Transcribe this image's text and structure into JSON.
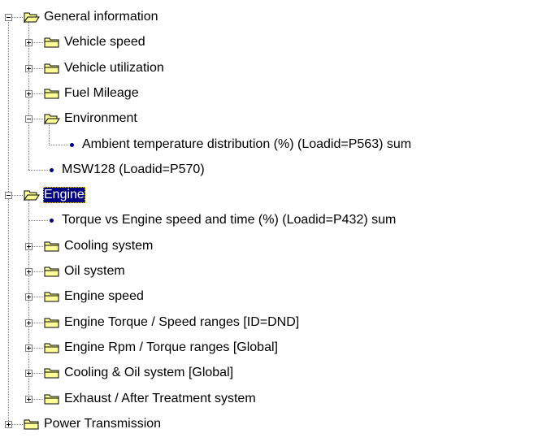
{
  "tree": {
    "nodes": [
      {
        "label": "General information",
        "level": 0,
        "kind": "folder",
        "expanded": true,
        "toggle": true
      },
      {
        "label": "Vehicle speed",
        "level": 1,
        "kind": "folder",
        "expanded": false,
        "toggle": true
      },
      {
        "label": "Vehicle utilization",
        "level": 1,
        "kind": "folder",
        "expanded": false,
        "toggle": true
      },
      {
        "label": "Fuel Mileage",
        "level": 1,
        "kind": "folder",
        "expanded": false,
        "toggle": true
      },
      {
        "label": "Environment",
        "level": 1,
        "kind": "folder",
        "expanded": true,
        "toggle": true
      },
      {
        "label": "Ambient temperature distribution (%)  (Loadid=P563) sum",
        "level": 2,
        "kind": "item",
        "toggle": false
      },
      {
        "label": "MSW128  (Loadid=P570)",
        "level": 1,
        "kind": "item",
        "toggle": false
      },
      {
        "label": "Engine",
        "level": 0,
        "kind": "folder",
        "expanded": true,
        "toggle": true,
        "selected": true
      },
      {
        "label": "Torque vs Engine speed and time (%)  (Loadid=P432) sum",
        "level": 1,
        "kind": "item",
        "toggle": false
      },
      {
        "label": "Cooling system",
        "level": 1,
        "kind": "folder",
        "expanded": false,
        "toggle": true
      },
      {
        "label": "Oil system",
        "level": 1,
        "kind": "folder",
        "expanded": false,
        "toggle": true
      },
      {
        "label": "Engine speed",
        "level": 1,
        "kind": "folder",
        "expanded": false,
        "toggle": true
      },
      {
        "label": "Engine Torque / Speed ranges [ID=DND]",
        "level": 1,
        "kind": "folder",
        "expanded": false,
        "toggle": true
      },
      {
        "label": "Engine Rpm / Torque ranges [Global]",
        "level": 1,
        "kind": "folder",
        "expanded": false,
        "toggle": true
      },
      {
        "label": "Cooling & Oil system [Global]",
        "level": 1,
        "kind": "folder",
        "expanded": false,
        "toggle": true
      },
      {
        "label": "Exhaust / After Treatment system",
        "level": 1,
        "kind": "folder",
        "expanded": false,
        "toggle": true
      },
      {
        "label": "Power Transmission",
        "level": 0,
        "kind": "folder",
        "expanded": false,
        "toggle": true
      }
    ]
  },
  "colors": {
    "folder_fill": "#ffff99",
    "folder_stroke": "#000000",
    "bullet": "#000080",
    "selection": "#000080",
    "tree_lines": "#808080"
  },
  "icons": {
    "folder_closed": "folder-closed-icon",
    "folder_open": "folder-open-icon",
    "item": "bullet-icon",
    "expand": "plus-icon",
    "collapse": "minus-icon"
  }
}
